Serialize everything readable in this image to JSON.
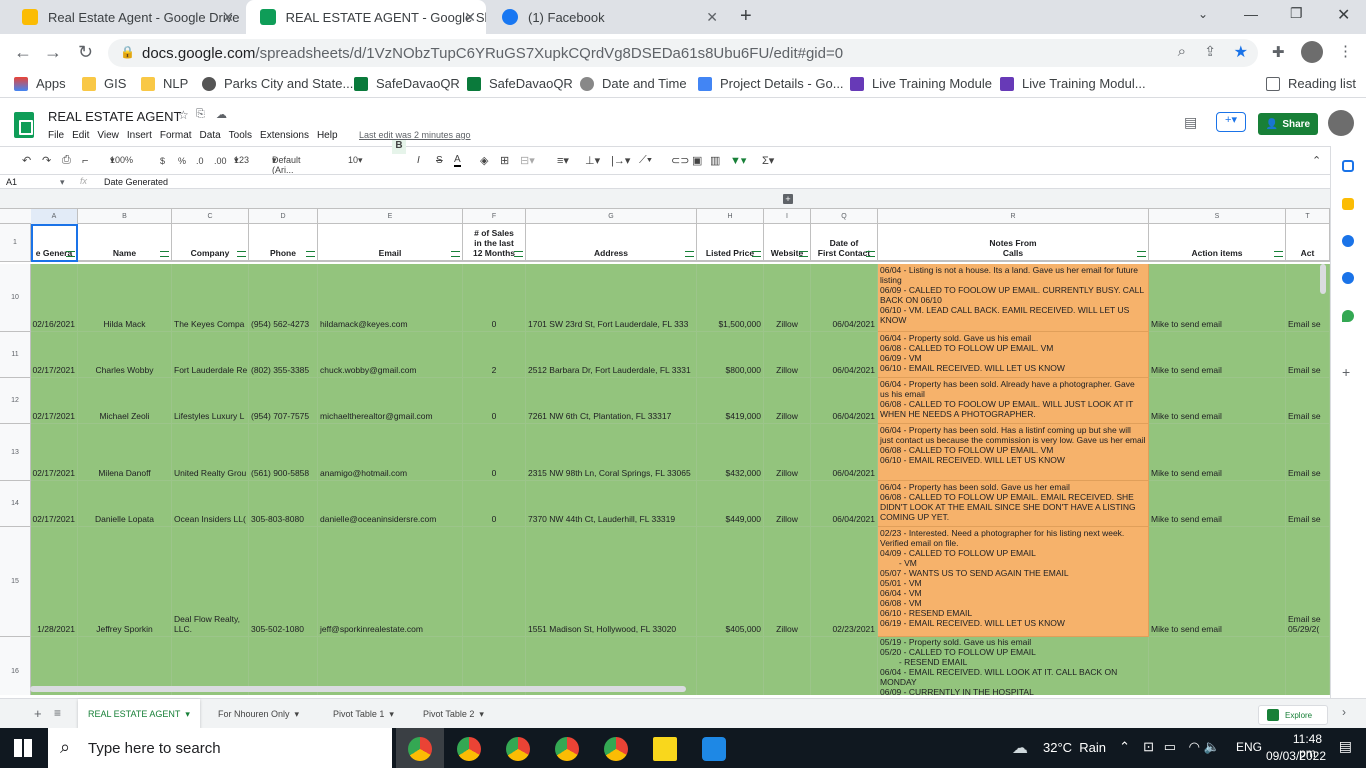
{
  "browser": {
    "tabs": [
      {
        "label": "Real Estate Agent - Google Drive",
        "icon": "google-drive-icon",
        "color": "#fbbc04",
        "active": false
      },
      {
        "label": "REAL ESTATE AGENT - Google Sh",
        "icon": "google-sheets-icon",
        "color": "#0f9d58",
        "active": true
      },
      {
        "label": "(1) Facebook",
        "icon": "facebook-icon",
        "color": "#1877f2",
        "active": false
      }
    ],
    "url_host": "docs.google.com",
    "url_path": "/spreadsheets/d/1VzNObzTupC6YRuGS7XupkCQrdVg8DSEDa61s8Ubu6FU/edit#gid=0",
    "bookmarks": [
      "Apps",
      "GIS",
      "NLP",
      "Parks City and State...",
      "SafeDavaoQR",
      "SafeDavaoQR",
      "Date and Time",
      "Project Details - Go...",
      "Live Training Module",
      "Live Training Modul..."
    ],
    "reading_list": "Reading list"
  },
  "sheets": {
    "title": "REAL ESTATE AGENT",
    "menus": [
      "File",
      "Edit",
      "View",
      "Insert",
      "Format",
      "Data",
      "Tools",
      "Extensions",
      "Help"
    ],
    "last_edit": "Last edit was 2 minutes ago",
    "share_label": "Share",
    "toolbar": {
      "zoom": "100%",
      "currency": "$",
      "percent": "%",
      "dec_less": ".0",
      "dec_more": ".00",
      "format": "123",
      "font": "Default (Ari...",
      "size": "10",
      "bold": "B",
      "italic": "I",
      "strike": "S",
      "color": "A"
    },
    "name_box": "A1",
    "fx": "fx",
    "formula": "Date Generated",
    "col_letters": [
      "A",
      "B",
      "C",
      "D",
      "E",
      "F",
      "G",
      "H",
      "I",
      "Q",
      "R",
      "S",
      "T"
    ],
    "headers": [
      "e Genera",
      "Name",
      "Company",
      "Phone",
      "Email",
      "# of Sales\nin the last\n12 Months",
      "Address",
      "Listed Price",
      "Website",
      "Date of\nFirst Contact",
      "Notes From\nCalls",
      "Action items",
      "Act"
    ],
    "rows": [
      {
        "num": "10",
        "cells": [
          "02/16/2021",
          "Hilda Mack",
          "The Keyes Compa",
          "(954) 562-4273",
          "hildamack@keyes.com",
          "0",
          "1701 SW 23rd St, Fort Lauderdale, FL 333",
          "$1,500,000",
          "Zillow",
          "06/04/2021",
          "06/04 - Listing is not a house. Its a land. Gave us her email for future listing\n06/09 - CALLED TO FOOLOW UP EMAIL. CURRENTLY BUSY. CALL BACK ON 06/10\n06/10 - VM. LEAD CALL BACK. EAMIL RECEIVED. WILL LET US KNOW",
          "Mike to send email",
          "Email se"
        ]
      },
      {
        "num": "11",
        "cells": [
          "02/17/2021",
          "Charles Wobby",
          "Fort Lauderdale Re",
          "(802) 355-3385",
          "chuck.wobby@gmail.com",
          "2",
          "2512 Barbara Dr, Fort Lauderdale, FL 3331",
          "$800,000",
          "Zillow",
          "06/04/2021",
          "06/04 - Property sold. Gave us his email\n06/08 - CALLED TO FOLLOW UP EMAIL. VM\n06/09 - VM\n06/10 - EMAIL RECEIVED. WILL LET US KNOW",
          "Mike to send email",
          "Email se"
        ]
      },
      {
        "num": "12",
        "cells": [
          "02/17/2021",
          "Michael Zeoli",
          "Lifestyles Luxury L",
          "(954) 707-7575",
          "michaeltherealtor@gmail.com",
          "0",
          "7261 NW 6th Ct, Plantation, FL 33317",
          "$419,000",
          "Zillow",
          "06/04/2021",
          "06/04 - Property has been sold. Already have a photographer. Gave us his email\n06/08 - CALLED TO FOOLOW UP EMAIL. WILL JUST LOOK AT IT WHEN HE NEEDS A PHOTOGRAPHER.",
          "Mike to send email",
          "Email se"
        ]
      },
      {
        "num": "13",
        "cells": [
          "02/17/2021",
          "Milena Danoff",
          "United Realty Grou",
          "(561) 900-5858",
          "anamigo@hotmail.com",
          "0",
          "2315 NW 98th Ln, Coral Springs, FL 33065",
          "$432,000",
          "Zillow",
          "06/04/2021",
          "06/04 - Property has been sold. Has a listinf coming up but she will just contact us because the commission is very low. Gave us her email\n06/08 - CALLED TO FOLLOW UP EMAIL. VM\n06/10 - EMAIL RECEIVED. WILL LET US KNOW",
          "Mike to send email",
          "Email se"
        ]
      },
      {
        "num": "14",
        "cells": [
          "02/17/2021",
          "Danielle Lopata",
          "Ocean Insiders LL(",
          "305-803-8080",
          "danielle@oceaninsidersre.com",
          "0",
          "7370 NW 44th Ct, Lauderhill, FL 33319",
          "$449,000",
          "Zillow",
          "06/04/2021",
          "06/04 - Property has been sold. Gave us her email\n06/08 - CALLED TO FOLLOW UP EMAIL. EMAIL RECEIVED. SHE DIDN'T LOOK AT THE EMAIL SINCE SHE DON'T HAVE A LISTING COMING UP YET.",
          "Mike to send email",
          "Email se"
        ]
      },
      {
        "num": "15",
        "cells": [
          "1/28/2021",
          "Jeffrey Sporkin",
          "Deal Flow Realty, LLC.",
          "305-502-1080",
          "jeff@sporkinrealestate.com",
          "",
          "1551 Madison St, Hollywood, FL 33020",
          "$405,000",
          "Zillow",
          "02/23/2021",
          "02/23 - Interested. Need a photographer for his listing next week. Verified email on file.\n04/09 - CALLED TO FOLLOW UP EMAIL\n        - VM\n05/07 - WANTS US TO SEND AGAIN THE EMAIL\n05/01 - VM\n06/04 - VM\n06/08 - VM\n06/10 - RESEND EMAIL\n06/19 - EMAIL RECEIVED. WILL LET US KNOW",
          "Mike to send email",
          "Email se\n05/29/2("
        ]
      },
      {
        "num": "16",
        "cells": [
          "",
          "",
          "",
          "",
          "",
          "",
          "",
          "",
          "",
          "",
          "05/19 - Property sold. Gave us his email\n05/20 - CALLED TO FOLLOW UP EMAIL\n        - RESEND EMAIL\n06/04 - EMAIL RECEIVED. WILL LOOK AT IT. CALL BACK ON MONDAY\n06/09 - CURRENTLY IN THE HOSPITAL",
          "",
          ""
        ]
      }
    ],
    "sheet_tabs": [
      "REAL ESTATE AGENT",
      "For Nhouren Only",
      "Pivot Table 1",
      "Pivot Table 2"
    ],
    "explore_label": "Explore"
  },
  "taskbar": {
    "search_placeholder": "Type here to search",
    "weather": "32°C  Rain",
    "lang": "ENG",
    "time": "11:48 pm",
    "date": "09/03/2022"
  }
}
